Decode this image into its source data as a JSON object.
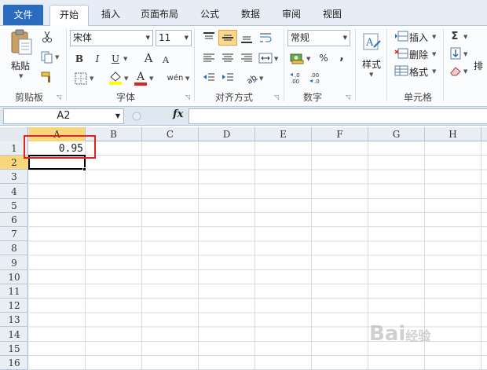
{
  "tabs": {
    "file": "文件",
    "home": "开始",
    "insert": "插入",
    "page_layout": "页面布局",
    "formulas": "公式",
    "data": "数据",
    "review": "审阅",
    "view": "视图"
  },
  "ribbon": {
    "clipboard": {
      "paste": "粘贴",
      "label": "剪贴板"
    },
    "font": {
      "name": "宋体",
      "size": "11",
      "label": "字体",
      "bold": "B",
      "italic": "I",
      "underline": "U",
      "grow": "A",
      "shrink": "A",
      "phonetic": "wén"
    },
    "alignment": {
      "label": "对齐方式"
    },
    "number": {
      "format": "常规",
      "label": "数字",
      "percent": "%",
      "comma": ",",
      "inc_dec": "←.0 .00",
      "dec_dec": ".00 →.0"
    },
    "styles": {
      "label": "样式"
    },
    "cells": {
      "insert": "插入",
      "delete": "删除",
      "format": "格式",
      "label": "单元格"
    },
    "editing": {
      "sum": "Σ",
      "sort_partial": "排"
    }
  },
  "formula_bar": {
    "name_box": "A2",
    "fx": "fx",
    "content": ""
  },
  "grid": {
    "columns": [
      "A",
      "B",
      "C",
      "D",
      "E",
      "F",
      "G",
      "H"
    ],
    "rows": [
      "1",
      "2",
      "3",
      "4",
      "5",
      "6",
      "7",
      "8",
      "9",
      "10",
      "11",
      "12",
      "13",
      "14",
      "15",
      "16"
    ],
    "selected_column": "A",
    "selected_row": "2",
    "cell_a1": "0.95"
  },
  "watermark": {
    "brand": "Bai",
    "suffix": "经验"
  },
  "colors": {
    "file_tab": "#2a6bbe",
    "highlight": "#e0231f",
    "header_selected": "#f8d67c"
  }
}
